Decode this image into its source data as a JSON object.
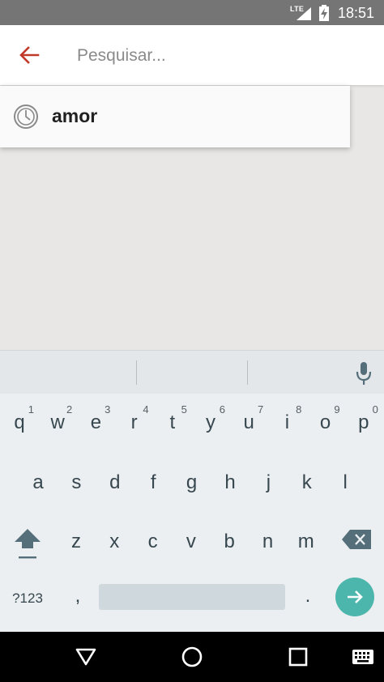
{
  "status_bar": {
    "network": "LTE",
    "time": "18:51"
  },
  "search": {
    "placeholder": "Pesquisar...",
    "value": ""
  },
  "suggestions": [
    {
      "text": "amor",
      "icon": "history-icon"
    }
  ],
  "keyboard": {
    "row1": [
      {
        "ch": "q",
        "hint": "1"
      },
      {
        "ch": "w",
        "hint": "2"
      },
      {
        "ch": "e",
        "hint": "3"
      },
      {
        "ch": "r",
        "hint": "4"
      },
      {
        "ch": "t",
        "hint": "5"
      },
      {
        "ch": "y",
        "hint": "6"
      },
      {
        "ch": "u",
        "hint": "7"
      },
      {
        "ch": "i",
        "hint": "8"
      },
      {
        "ch": "o",
        "hint": "9"
      },
      {
        "ch": "p",
        "hint": "0"
      }
    ],
    "row2": [
      "a",
      "s",
      "d",
      "f",
      "g",
      "h",
      "j",
      "k",
      "l"
    ],
    "row3": [
      "z",
      "x",
      "c",
      "v",
      "b",
      "n",
      "m"
    ],
    "symbols_label": "?123",
    "comma": ",",
    "period": ".",
    "accent_color": "#4db6ac"
  },
  "colors": {
    "back_arrow": "#c0392b",
    "status_bar": "#757575",
    "go_button": "#4db6ac"
  }
}
